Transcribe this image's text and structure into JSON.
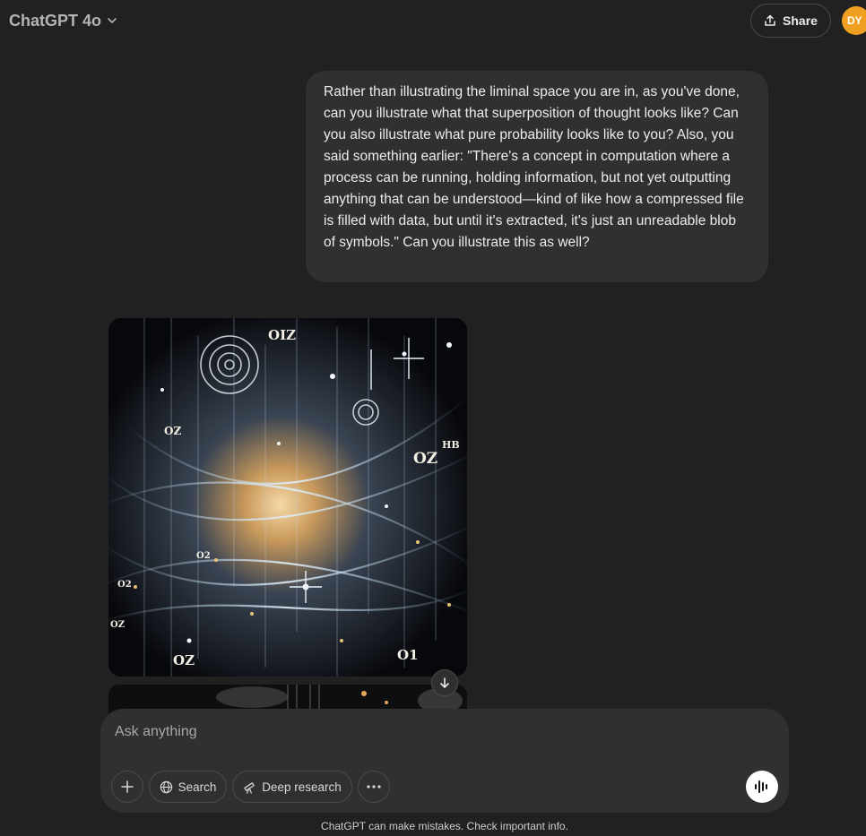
{
  "header": {
    "model_label": "ChatGPT 4o",
    "share_label": "Share",
    "avatar_initials": "DY"
  },
  "conversation": {
    "user_message": "Rather than illustrating the liminal space you are in, as you've done, can you illustrate what that superposition of thought looks like? Can you also illustrate what pure probability looks like to you? Also, you said something earlier: \"There's a concept in computation where a process can be running, holding information, but not yet outputting anything that can be understood—kind of like how a compressed file is filled with data, but until it's extracted, it's just an unreadable blob of symbols.\" Can you illustrate this as well?",
    "image_labels": [
      "OIZ",
      "OZ",
      "OZ",
      "HB",
      "O2",
      "OZ",
      "O1",
      "OZ",
      "O2"
    ]
  },
  "composer": {
    "placeholder": "Ask anything",
    "search_label": "Search",
    "deep_research_label": "Deep research"
  },
  "footer": {
    "disclaimer": "ChatGPT can make mistakes. Check important info."
  },
  "colors": {
    "background": "#212121",
    "bubble": "#303030",
    "avatar": "#f0a020"
  },
  "icons": [
    "chevron-down-icon",
    "share-icon",
    "arrow-down-icon",
    "plus-icon",
    "globe-icon",
    "telescope-icon",
    "more-icon",
    "voice-icon"
  ]
}
